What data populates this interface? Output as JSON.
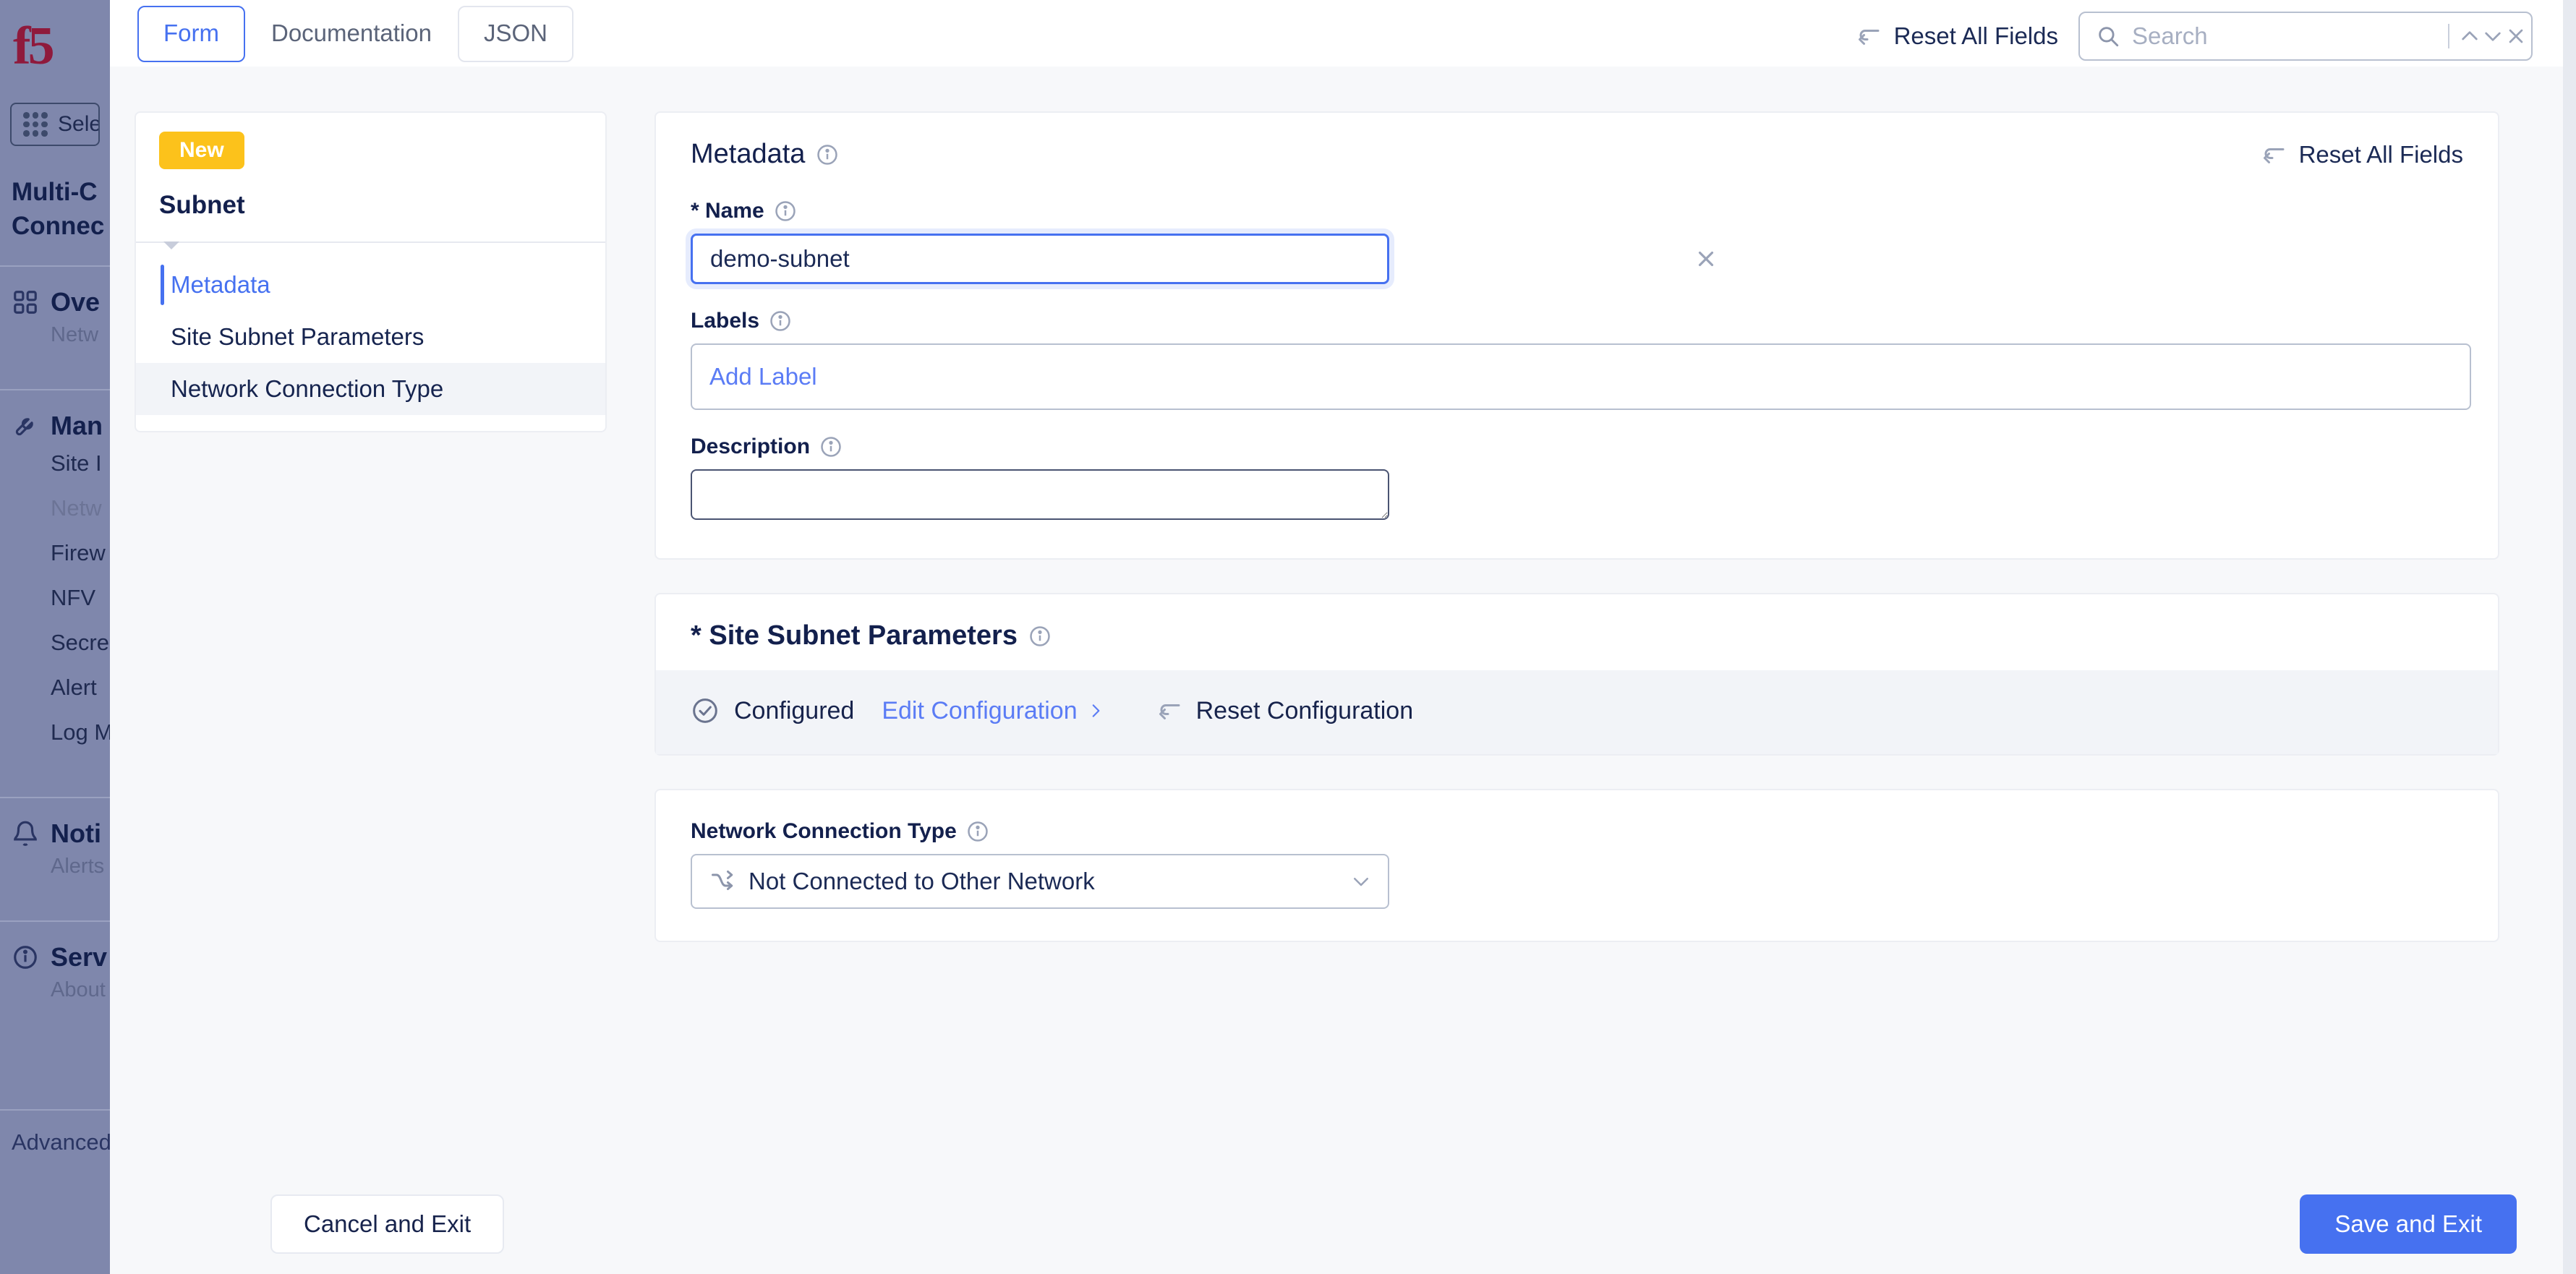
{
  "background_app": {
    "logo": "f5",
    "selector": {
      "label": "Sele",
      "icon": "grid-dots-icon"
    },
    "title": "Multi-C\nConnec",
    "sections": [
      {
        "icon": "grid-squares-icon",
        "title": "Ove",
        "subtitle": "Netw"
      },
      {
        "icon": "wrench-icon",
        "title": "Man",
        "subtitle": "",
        "links": [
          "Site I",
          "Netw",
          "Firew",
          "NFV",
          "Secre",
          "Alert",
          "Log M"
        ]
      },
      {
        "icon": "bell-icon",
        "title": "Noti",
        "subtitle": "Alerts"
      },
      {
        "icon": "info-circle-icon",
        "title": "Serv",
        "subtitle": "About"
      }
    ],
    "advanced_label": "Advanced"
  },
  "header": {
    "tabs": [
      {
        "label": "Form",
        "active": true
      },
      {
        "label": "Documentation",
        "active": false
      },
      {
        "label": "JSON",
        "active": false
      }
    ],
    "reset_all_fields": "Reset All Fields",
    "search": {
      "placeholder": "Search",
      "value": ""
    },
    "search_prev_icon": "chevron-up-icon",
    "search_next_icon": "chevron-down-icon",
    "search_close_icon": "close-icon"
  },
  "nav_panel": {
    "badge": "New",
    "object_name": "Subnet",
    "items": [
      {
        "label": "Metadata",
        "active": true,
        "hover": false
      },
      {
        "label": "Site Subnet Parameters",
        "active": false,
        "hover": false
      },
      {
        "label": "Network Connection Type",
        "active": false,
        "hover": true
      }
    ]
  },
  "metadata_card": {
    "title": "Metadata",
    "reset_all_fields": "Reset All Fields",
    "name": {
      "label": "* Name",
      "value": "demo-subnet",
      "placeholder": ""
    },
    "labels": {
      "label": "Labels",
      "add_label": "Add Label"
    },
    "description": {
      "label": "Description",
      "value": "",
      "placeholder": ""
    }
  },
  "site_subnet_card": {
    "title": "* Site Subnet Parameters",
    "status": "Configured",
    "edit_configuration": "Edit Configuration",
    "reset_configuration": "Reset Configuration"
  },
  "network_card": {
    "label": "Network Connection Type",
    "selected": "Not Connected to Other Network"
  },
  "footer": {
    "cancel": "Cancel and Exit",
    "save": "Save and Exit"
  },
  "colors": {
    "accent_blue": "#4671f0",
    "badge_yellow": "#fcc21b",
    "text_navy": "#13204d",
    "sidebar_bg": "#7f87ac",
    "panel_bg": "#f7f8fa"
  }
}
